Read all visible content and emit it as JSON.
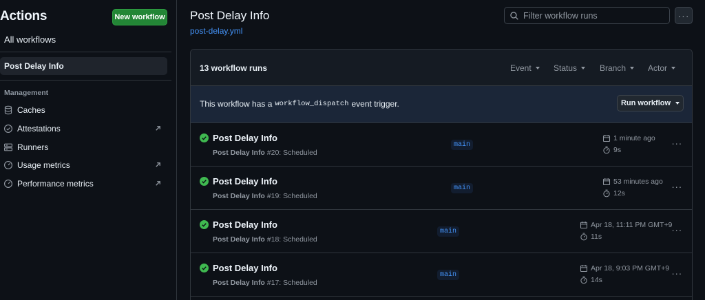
{
  "sidebar": {
    "title": "Actions",
    "new_workflow": "New workflow",
    "all_workflows": "All workflows",
    "active_workflow": "Post Delay Info",
    "section": "Management",
    "items": [
      {
        "label": "Caches",
        "icon": "database-icon",
        "external": false
      },
      {
        "label": "Attestations",
        "icon": "verified-icon",
        "external": true
      },
      {
        "label": "Runners",
        "icon": "server-icon",
        "external": false
      },
      {
        "label": "Usage metrics",
        "icon": "meter-icon",
        "external": true
      },
      {
        "label": "Performance metrics",
        "icon": "meter-icon",
        "external": true
      }
    ]
  },
  "header": {
    "title": "Post Delay Info",
    "file": "post-delay.yml",
    "filter_placeholder": "Filter workflow runs"
  },
  "runs": {
    "count_label": "13 workflow runs",
    "filters": [
      "Event",
      "Status",
      "Branch",
      "Actor"
    ],
    "dispatch": {
      "prefix": "This workflow has a",
      "code": "workflow_dispatch",
      "suffix": "event trigger.",
      "button": "Run workflow"
    },
    "items": [
      {
        "title": "Post Delay Info",
        "workflow": "Post Delay Info",
        "detail": "#20: Scheduled",
        "branch": "main",
        "time": "1 minute ago",
        "duration": "9s",
        "status": "success"
      },
      {
        "title": "Post Delay Info",
        "workflow": "Post Delay Info",
        "detail": "#19: Scheduled",
        "branch": "main",
        "time": "53 minutes ago",
        "duration": "12s",
        "status": "success"
      },
      {
        "title": "Post Delay Info",
        "workflow": "Post Delay Info",
        "detail": "#18: Scheduled",
        "branch": "main",
        "time": "Apr 18, 11:11 PM GMT+9",
        "duration": "11s",
        "status": "success"
      },
      {
        "title": "Post Delay Info",
        "workflow": "Post Delay Info",
        "detail": "#17: Scheduled",
        "branch": "main",
        "time": "Apr 18, 9:03 PM GMT+9",
        "duration": "14s",
        "status": "success"
      }
    ]
  },
  "colors": {
    "background": "#0d1117",
    "accent_green": "#238636",
    "success": "#3fb950",
    "link": "#4493f8",
    "dispatch_bg": "#1b2638"
  }
}
